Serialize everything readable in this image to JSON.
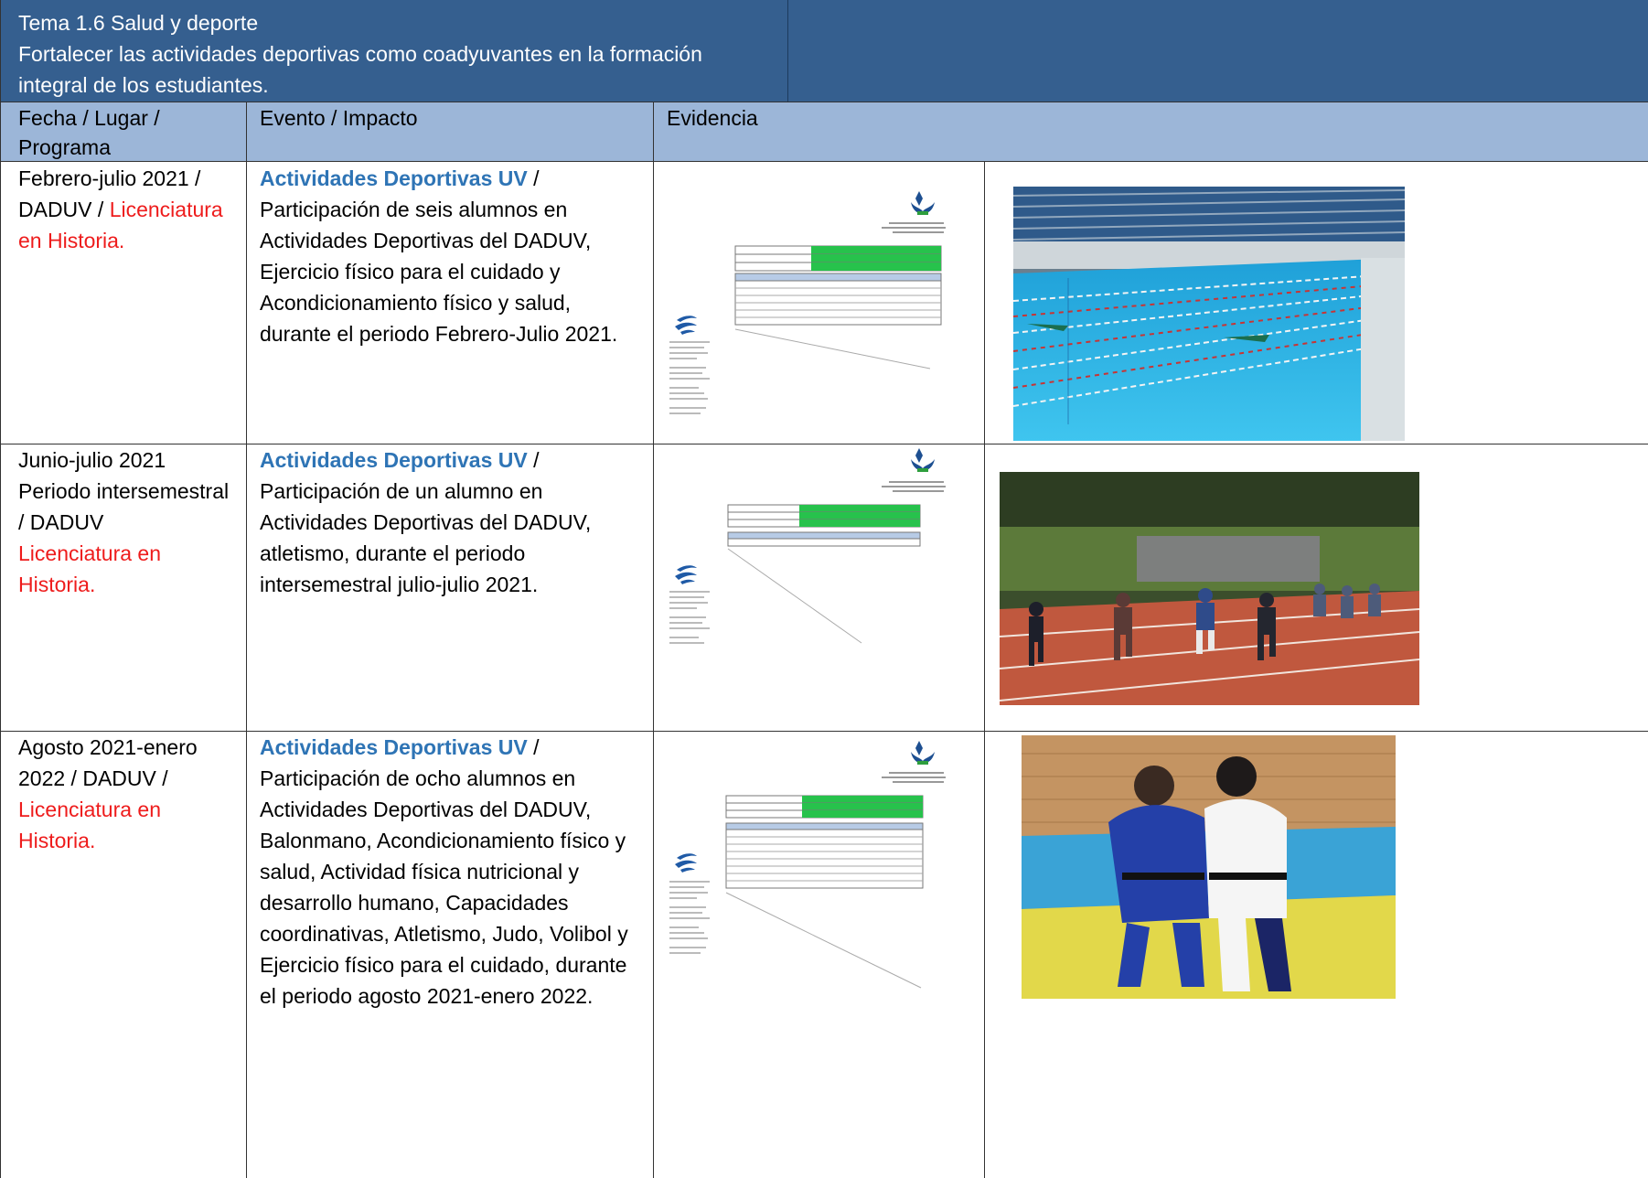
{
  "header": {
    "title": "Tema 1.6 Salud y deporte",
    "objective_line1": "Fortalecer las actividades deportivas como coadyuvantes en la formación",
    "objective_line2": "integral de los estudiantes."
  },
  "columns": {
    "col1_line1": "Fecha / Lugar /",
    "col1_line2": "Programa",
    "col2": "Evento / Impacto",
    "col3": "Evidencia"
  },
  "rows": [
    {
      "date_lines": [
        "Febrero-julio 2021 /",
        "DADUV / "
      ],
      "program_parts": [
        "Licenciatura",
        "en Historia."
      ],
      "event_title": "Actividades Deportivas UV",
      "event_sep": " /",
      "event_lines": [
        "Participación de seis alumnos en",
        "Actividades Deportivas del DADUV,",
        "Ejercicio físico para el cuidado y",
        "Acondicionamiento físico y salud,",
        "durante el periodo Febrero-Julio 2021."
      ],
      "photo_desc": "swimming-pool-photo"
    },
    {
      "date_lines": [
        "Junio-julio 2021",
        "Periodo intersemestral",
        "/ DADUV"
      ],
      "program_parts": [
        "Licenciatura en",
        "Historia."
      ],
      "event_title": "Actividades Deportivas UV",
      "event_sep": " /",
      "event_lines": [
        "Participación de un alumno en",
        "Actividades Deportivas del DADUV,",
        "atletismo, durante el periodo",
        "intersemestral julio-julio 2021."
      ],
      "photo_desc": "running-track-photo"
    },
    {
      "date_lines": [
        "Agosto 2021-enero",
        "2022 / DADUV /"
      ],
      "program_parts": [
        "Licenciatura en",
        "Historia."
      ],
      "event_title": "Actividades Deportivas UV",
      "event_sep": " /",
      "event_lines": [
        "Participación de ocho alumnos en",
        "Actividades Deportivas del DADUV,",
        "Balonmano, Acondicionamiento físico y",
        "salud, Actividad física nutricional y",
        "desarrollo humano, Capacidades",
        "coordinativas, Atletismo, Judo, Volibol y",
        "Ejercicio físico para el cuidado, durante",
        "el periodo agosto 2021-enero 2022."
      ],
      "photo_desc": "judo-photo"
    }
  ],
  "colors": {
    "header_dark": "#355f8f",
    "header_light": "#9cb6d8",
    "link_blue": "#2e74b5",
    "program_red": "#ee1c1c"
  }
}
